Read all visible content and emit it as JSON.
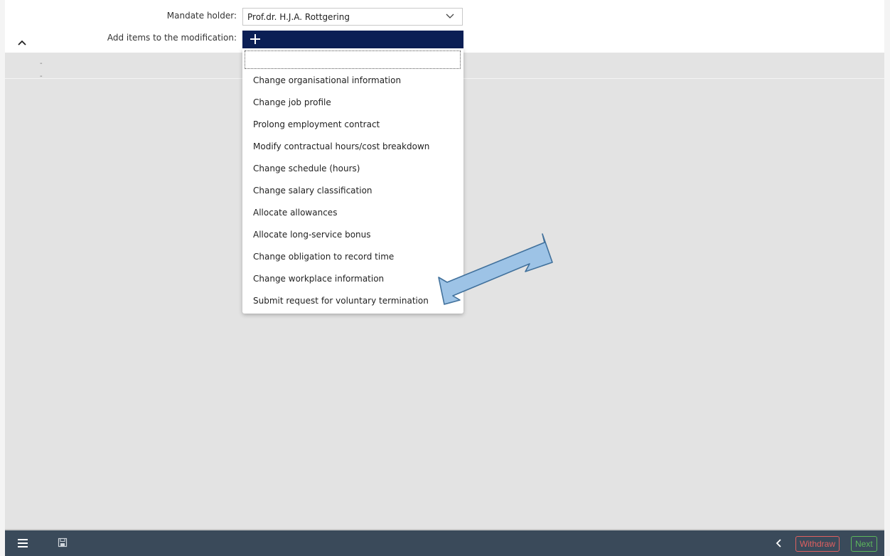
{
  "form": {
    "mandate_holder_label": "Mandate holder:",
    "mandate_holder_value": "Prof.dr. H.J.A. Rottgering",
    "add_items_label": "Add items to the modification:"
  },
  "dropdown": {
    "search_value": "",
    "items": [
      "Change organisational information",
      "Change job profile",
      "Prolong employment contract",
      "Modify contractual hours/cost breakdown",
      "Change schedule (hours)",
      "Change salary classification",
      "Allocate allowances",
      "Allocate long-service bonus",
      "Change obligation to record time",
      "Change workplace information",
      "Submit request for voluntary termination"
    ]
  },
  "content": {
    "dash_1": "-",
    "dash_2": "-"
  },
  "footer": {
    "withdraw_label": "Withdraw",
    "next_label": "Next"
  },
  "icons": {
    "menu": "hamburger-menu-icon",
    "save": "save-icon",
    "back": "chevron-left-icon",
    "collapse": "chevron-up-icon",
    "dropdown": "chevron-down-icon",
    "add": "plus-icon"
  },
  "colors": {
    "add_bar": "#0b1f55",
    "footer": "#3a4a5a",
    "content_bg": "#e3e3e3",
    "withdraw": "#e06060",
    "next": "#5cb85c",
    "arrow_fill": "#9dc3e6",
    "arrow_stroke": "#41719c"
  }
}
